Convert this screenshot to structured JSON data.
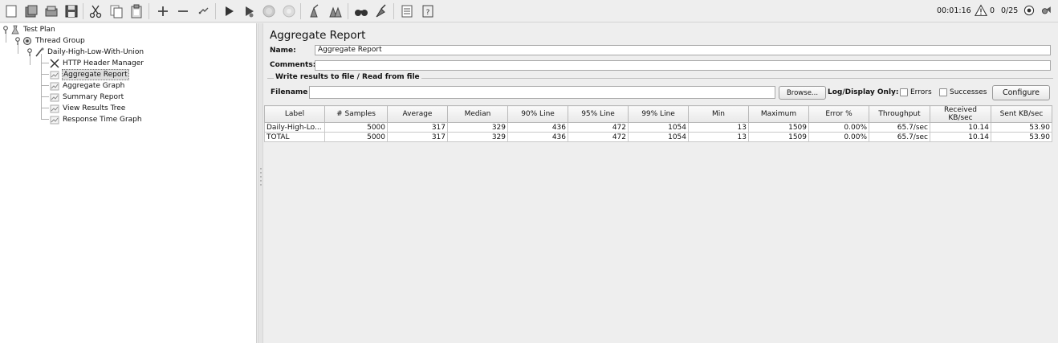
{
  "app": {
    "elapsed_time": "00:01:16",
    "warning_count": "0",
    "threads": "0/25"
  },
  "toolbar": {
    "icons": [
      "new-icon",
      "templates-icon",
      "open-icon",
      "save-icon",
      "cut-icon",
      "copy-icon",
      "paste-icon",
      "expand-icon",
      "collapse-icon",
      "toggle-icon",
      "start-icon",
      "start-no-pauses-icon",
      "stop-icon",
      "shutdown-icon",
      "clear-icon",
      "clear-all-icon",
      "search-icon",
      "reset-search-icon",
      "function-helper-icon",
      "help-icon"
    ]
  },
  "tree": {
    "nodes": [
      {
        "label": "Test Plan",
        "icon": "test-plan-icon",
        "depth": 0
      },
      {
        "label": "Thread Group",
        "icon": "thread-group-icon",
        "depth": 1
      },
      {
        "label": "Daily-High-Low-With-Union",
        "icon": "sampler-icon",
        "depth": 2
      },
      {
        "label": "HTTP Header Manager",
        "icon": "config-element-icon",
        "depth": 3
      },
      {
        "label": "Aggregate Report",
        "icon": "listener-icon",
        "depth": 3,
        "selected": true
      },
      {
        "label": "Aggregate Graph",
        "icon": "listener-icon",
        "depth": 3
      },
      {
        "label": "Summary Report",
        "icon": "listener-icon",
        "depth": 3
      },
      {
        "label": "View Results Tree",
        "icon": "listener-icon",
        "depth": 3
      },
      {
        "label": "Response Time Graph",
        "icon": "listener-icon",
        "depth": 3
      }
    ]
  },
  "panel": {
    "title": "Aggregate Report",
    "name_label": "Name:",
    "name_value": "Aggregate Report",
    "comments_label": "Comments:",
    "comments_value": "",
    "file_group_legend": "Write results to file / Read from file",
    "filename_label": "Filename",
    "filename_value": "",
    "browse_label": "Browse...",
    "log_display_label": "Log/Display Only:",
    "errors_label": "Errors",
    "successes_label": "Successes",
    "configure_label": "Configure"
  },
  "table": {
    "columns": [
      "Label",
      "# Samples",
      "Average",
      "Median",
      "90% Line",
      "95% Line",
      "99% Line",
      "Min",
      "Maximum",
      "Error %",
      "Throughput",
      "Received KB/sec",
      "Sent KB/sec"
    ],
    "rows": [
      [
        "Daily-High-Lo...",
        "5000",
        "317",
        "329",
        "436",
        "472",
        "1054",
        "13",
        "1509",
        "0.00%",
        "65.7/sec",
        "10.14",
        "53.90"
      ],
      [
        "TOTAL",
        "5000",
        "317",
        "329",
        "436",
        "472",
        "1054",
        "13",
        "1509",
        "0.00%",
        "65.7/sec",
        "10.14",
        "53.90"
      ]
    ]
  },
  "colors": {
    "background": "#eeeeee",
    "tree_background": "#ffffff",
    "selection": "#dcdcdc",
    "run_green": "#2e7d32"
  }
}
